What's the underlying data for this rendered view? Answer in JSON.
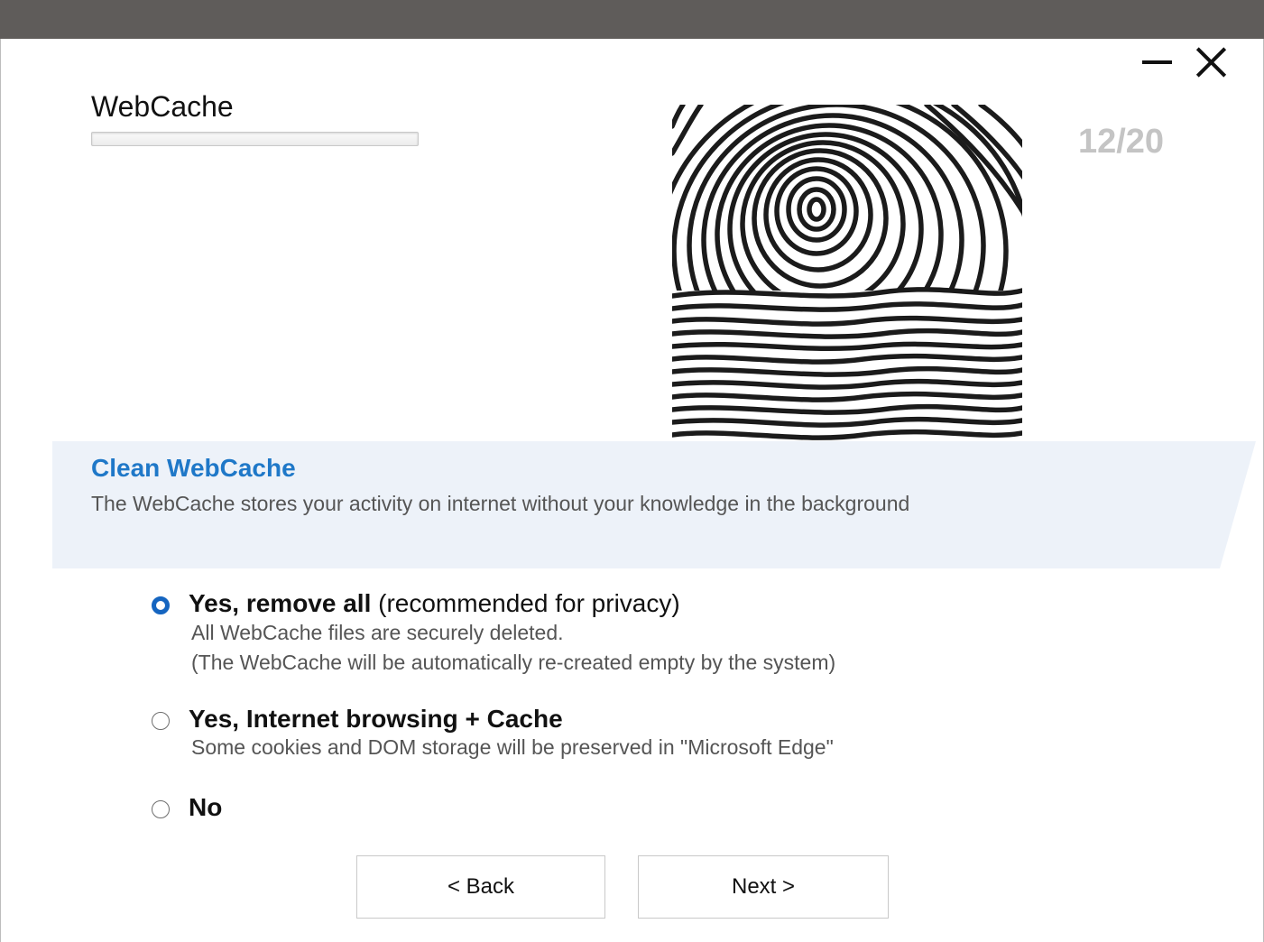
{
  "app": {
    "title": "WebCache",
    "progress_fraction": 0.0,
    "step": "12/20"
  },
  "banner": {
    "heading": "Clean WebCache",
    "description": "The WebCache stores your activity on internet without your knowledge in the background",
    "background_color": "#edf2f9"
  },
  "options": [
    {
      "title_bold": "Yes, remove all",
      "title_rest": " (recommended for privacy)",
      "sub1": "All WebCache files are securely deleted.",
      "sub2": "(The WebCache will be automatically re-created empty by the system)",
      "selected": true
    },
    {
      "title_bold": "Yes, Internet browsing + Cache",
      "sub1": "Some cookies and DOM storage will be preserved in \"Microsoft Edge\"",
      "selected": false
    },
    {
      "title_bold": "No",
      "selected": false
    }
  ],
  "buttons": {
    "back": "< Back",
    "next": "Next >"
  },
  "icons": {
    "minimize": "minimize-icon",
    "close": "close-icon",
    "illustration": "fingerprint-image"
  },
  "colors": {
    "accent": "#1f78c8",
    "radio_selected": "#1565c0",
    "titlebar": "#5f5c5a"
  }
}
